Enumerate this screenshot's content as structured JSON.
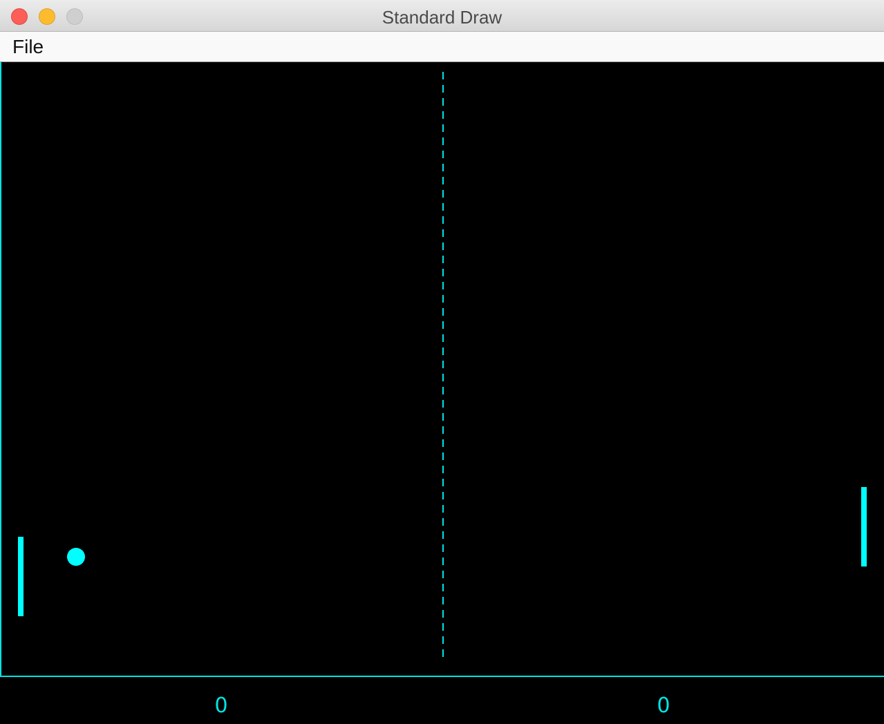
{
  "window": {
    "title": "Standard Draw"
  },
  "menu": {
    "items": [
      {
        "label": "File"
      }
    ]
  },
  "game": {
    "colors": {
      "background": "#000000",
      "foreground": "#00ffff",
      "lines": "#00e5e5"
    },
    "scores": {
      "left": "0",
      "right": "0"
    }
  }
}
